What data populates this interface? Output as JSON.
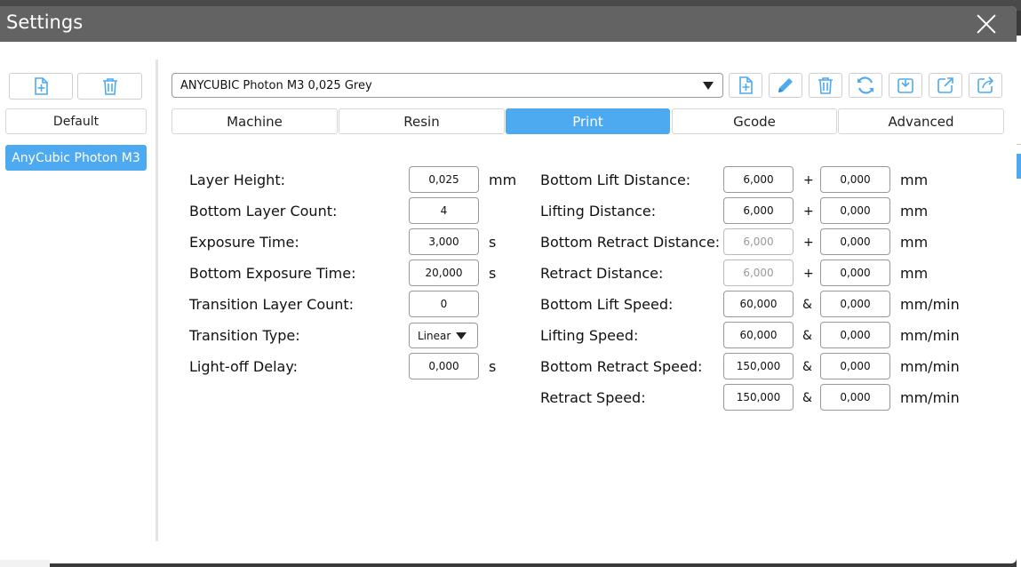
{
  "window": {
    "title": "Settings"
  },
  "sidebar": {
    "items": [
      {
        "label": "Default",
        "active": false
      },
      {
        "label": "AnyCubic Photon M3",
        "active": true
      }
    ]
  },
  "profile": {
    "selected": "ANYCUBIC Photon M3 0,025 Grey"
  },
  "toolbar": {
    "icons": [
      "add-file-icon",
      "edit-icon",
      "delete-icon",
      "refresh-icon",
      "import-icon",
      "export-icon",
      "share-icon"
    ]
  },
  "tabs": [
    {
      "label": "Machine",
      "active": false
    },
    {
      "label": "Resin",
      "active": false
    },
    {
      "label": "Print",
      "active": true
    },
    {
      "label": "Gcode",
      "active": false
    },
    {
      "label": "Advanced",
      "active": false
    }
  ],
  "left_fields": {
    "layer_height": {
      "label": "Layer Height:",
      "value": "0,025",
      "unit": "mm"
    },
    "bottom_layer_count": {
      "label": "Bottom Layer Count:",
      "value": "4",
      "unit": ""
    },
    "exposure_time": {
      "label": "Exposure Time:",
      "value": "3,000",
      "unit": "s"
    },
    "bottom_exposure_time": {
      "label": "Bottom Exposure Time:",
      "value": "20,000",
      "unit": "s"
    },
    "transition_layer_count": {
      "label": "Transition Layer Count:",
      "value": "0",
      "unit": ""
    },
    "transition_type": {
      "label": "Transition Type:",
      "value": "Linear"
    },
    "light_off_delay": {
      "label": "Light-off Delay:",
      "value": "0,000",
      "unit": "s"
    }
  },
  "right_fields": {
    "bottom_lift_distance": {
      "label": "Bottom Lift Distance:",
      "value1": "6,000",
      "op": "+",
      "value2": "0,000",
      "unit": "mm"
    },
    "lifting_distance": {
      "label": "Lifting Distance:",
      "value1": "6,000",
      "op": "+",
      "value2": "0,000",
      "unit": "mm"
    },
    "bottom_retract_distance": {
      "label": "Bottom Retract Distance:",
      "value1": "6,000",
      "op": "+",
      "value2": "0,000",
      "unit": "mm"
    },
    "retract_distance": {
      "label": "Retract Distance:",
      "value1": "6,000",
      "op": "+",
      "value2": "0,000",
      "unit": "mm"
    },
    "bottom_lift_speed": {
      "label": "Bottom Lift Speed:",
      "value1": "60,000",
      "op": "&",
      "value2": "0,000",
      "unit": "mm/min"
    },
    "lifting_speed": {
      "label": "Lifting Speed:",
      "value1": "60,000",
      "op": "&",
      "value2": "0,000",
      "unit": "mm/min"
    },
    "bottom_retract_speed": {
      "label": "Bottom Retract Speed:",
      "value1": "150,000",
      "op": "&",
      "value2": "0,000",
      "unit": "mm/min"
    },
    "retract_speed": {
      "label": "Retract Speed:",
      "value1": "150,000",
      "op": "&",
      "value2": "0,000",
      "unit": "mm/min"
    }
  },
  "colors": {
    "accent": "#4daaf0",
    "titlebar": "#636363"
  }
}
